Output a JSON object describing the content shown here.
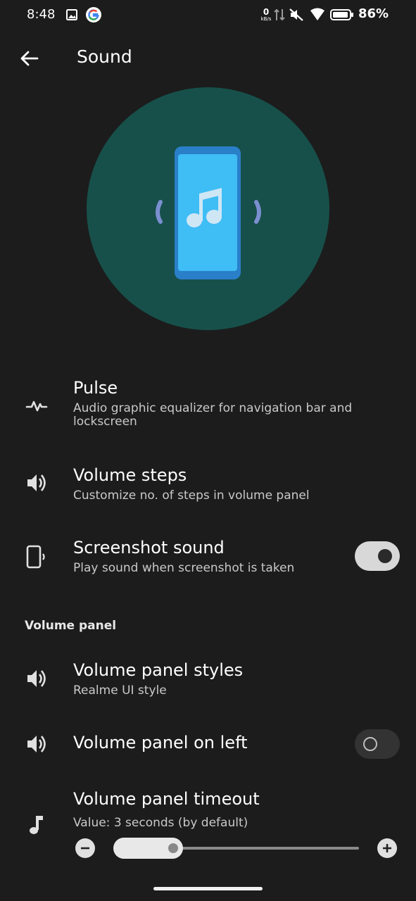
{
  "status_bar": {
    "time": "8:48",
    "netspeed_value": "0",
    "netspeed_unit": "kB/s",
    "battery_percent": "86%"
  },
  "app_bar": {
    "title": "Sound"
  },
  "settings": [
    {
      "title": "Pulse",
      "subtitle": "Audio graphic equalizer for navigation bar and lockscreen",
      "icon": "pulse-icon"
    },
    {
      "title": "Volume steps",
      "subtitle": "Customize no. of steps in volume panel",
      "icon": "volume-icon"
    },
    {
      "title": "Screenshot sound",
      "subtitle": "Play sound when screenshot is taken",
      "icon": "phone-sound-icon",
      "toggle": true
    }
  ],
  "volume_panel_section": {
    "header": "Volume panel",
    "items": [
      {
        "title": "Volume panel styles",
        "subtitle": "Realme UI style",
        "icon": "volume-icon"
      },
      {
        "title": "Volume panel on left",
        "icon": "volume-icon",
        "toggle": false
      },
      {
        "title": "Volume panel timeout",
        "subtitle": "Value: 3 seconds (by default)",
        "icon": "music-note-icon",
        "slider_fraction": 0.24
      }
    ]
  },
  "colors": {
    "background": "#1c1c1c",
    "hero_circle": "#17504a",
    "phone_screen": "#3fbdf5",
    "phone_body": "#2a7fc9"
  }
}
